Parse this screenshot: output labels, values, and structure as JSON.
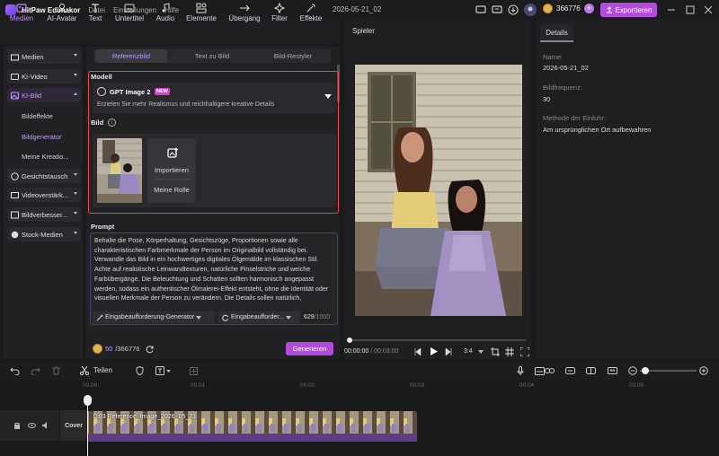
{
  "app": {
    "name": "HitPaw Edimakor",
    "menus": [
      "Datei",
      "Einstellungen",
      "Hilfe"
    ],
    "project_name": "2026-05-21_02",
    "credits": "366776",
    "export_label": "Exportieren"
  },
  "toolbar": [
    {
      "label": "Medien",
      "icon": "media-icon",
      "active": true
    },
    {
      "label": "AI-Avatar",
      "icon": "avatar-icon"
    },
    {
      "label": "Text",
      "icon": "text-icon"
    },
    {
      "label": "Untertitel",
      "icon": "subtitle-icon"
    },
    {
      "label": "Audio",
      "icon": "music-icon"
    },
    {
      "label": "Elemente",
      "icon": "elements-icon"
    },
    {
      "label": "Übergang",
      "icon": "transition-icon"
    },
    {
      "label": "Filter",
      "icon": "filter-icon"
    },
    {
      "label": "Effekte",
      "icon": "effects-icon"
    }
  ],
  "sidebar": {
    "items": [
      {
        "label": "Medien"
      },
      {
        "label": "KI-Video"
      },
      {
        "label": "KI-Bild",
        "active": true
      },
      {
        "label": "Gesichtstausch"
      },
      {
        "label": "Videoverstärk..."
      },
      {
        "label": "Bildverbesser..."
      },
      {
        "label": "Stock-Medien"
      }
    ],
    "subitems": [
      {
        "label": "Bildeffekte"
      },
      {
        "label": "Bildgenerator",
        "active": true
      },
      {
        "label": "Meine Kreatio..."
      }
    ]
  },
  "panel": {
    "tabs": [
      {
        "label": "Referenzbild",
        "active": true
      },
      {
        "label": "Text zu Bild"
      },
      {
        "label": "Bild-Restyler"
      }
    ],
    "model_label": "Modell",
    "model_name": "GPT Image 2",
    "model_badge": "NEW",
    "model_desc": "Erzielen Sie mehr Realismus und reichhaltigere kreative Details",
    "bild_label": "Bild",
    "import_label": "Importieren",
    "role_label": "Meine Rolle",
    "prompt_label": "Prompt",
    "prompt_text": "Behalte die Pose, Körperhaltung, Gesichtszüge, Proportionen sowie alle charakteristischen Farbmerkmale der Person im Originalbild vollständig bei. Verwandle das Bild in ein hochwertiges digitales Ölgemälde im klassischen Stil. Achte auf realistische Leinwandtexturen, natürliche Pinselstriche und weiche Farbübergänge. Die Beleuchtung und Schatten sollten harmonisch angepasst werden, sodass ein authentischer Ölmalerei-Effekt entsteht, ohne die Identität oder visuellen Merkmale der Person zu verändern. Die Details sollen natürlich, künstlerisch und professionell wirken, wie ein handgemaltes",
    "prompt_gen_btn": "Eingabeaufforderung-Generator",
    "prompt_opt_btn": "Eingabeaufforder...",
    "char_count": "629",
    "char_max": "/1000",
    "cost": "50",
    "balance": "/366776",
    "generate_label": "Generieren"
  },
  "player": {
    "label": "Spieler",
    "time_current": "00:00:00",
    "time_total": " / 00:03:00",
    "ratio": "3:4"
  },
  "details": {
    "tab": "Details",
    "name_label": "Name:",
    "name_value": "2026-05-21_02",
    "fps_label": "Bildfrequenz:",
    "fps_value": "30",
    "method_label": "Methode der Einfuhr:",
    "method_value": "Am ursprünglichen Ort aufbewahren"
  },
  "timeline": {
    "split_label": "Teilen",
    "cover_label": "Cover",
    "clip_label": "0:03 Reference_Image_2026_05_21",
    "ruler": [
      "00:00",
      "00:01",
      "00:02",
      "00:03",
      "00:04",
      "00:05"
    ]
  },
  "colors": {
    "accent": "#b44be0",
    "accent_text": "#c39bff",
    "highlight_border": "#e24b4b"
  }
}
